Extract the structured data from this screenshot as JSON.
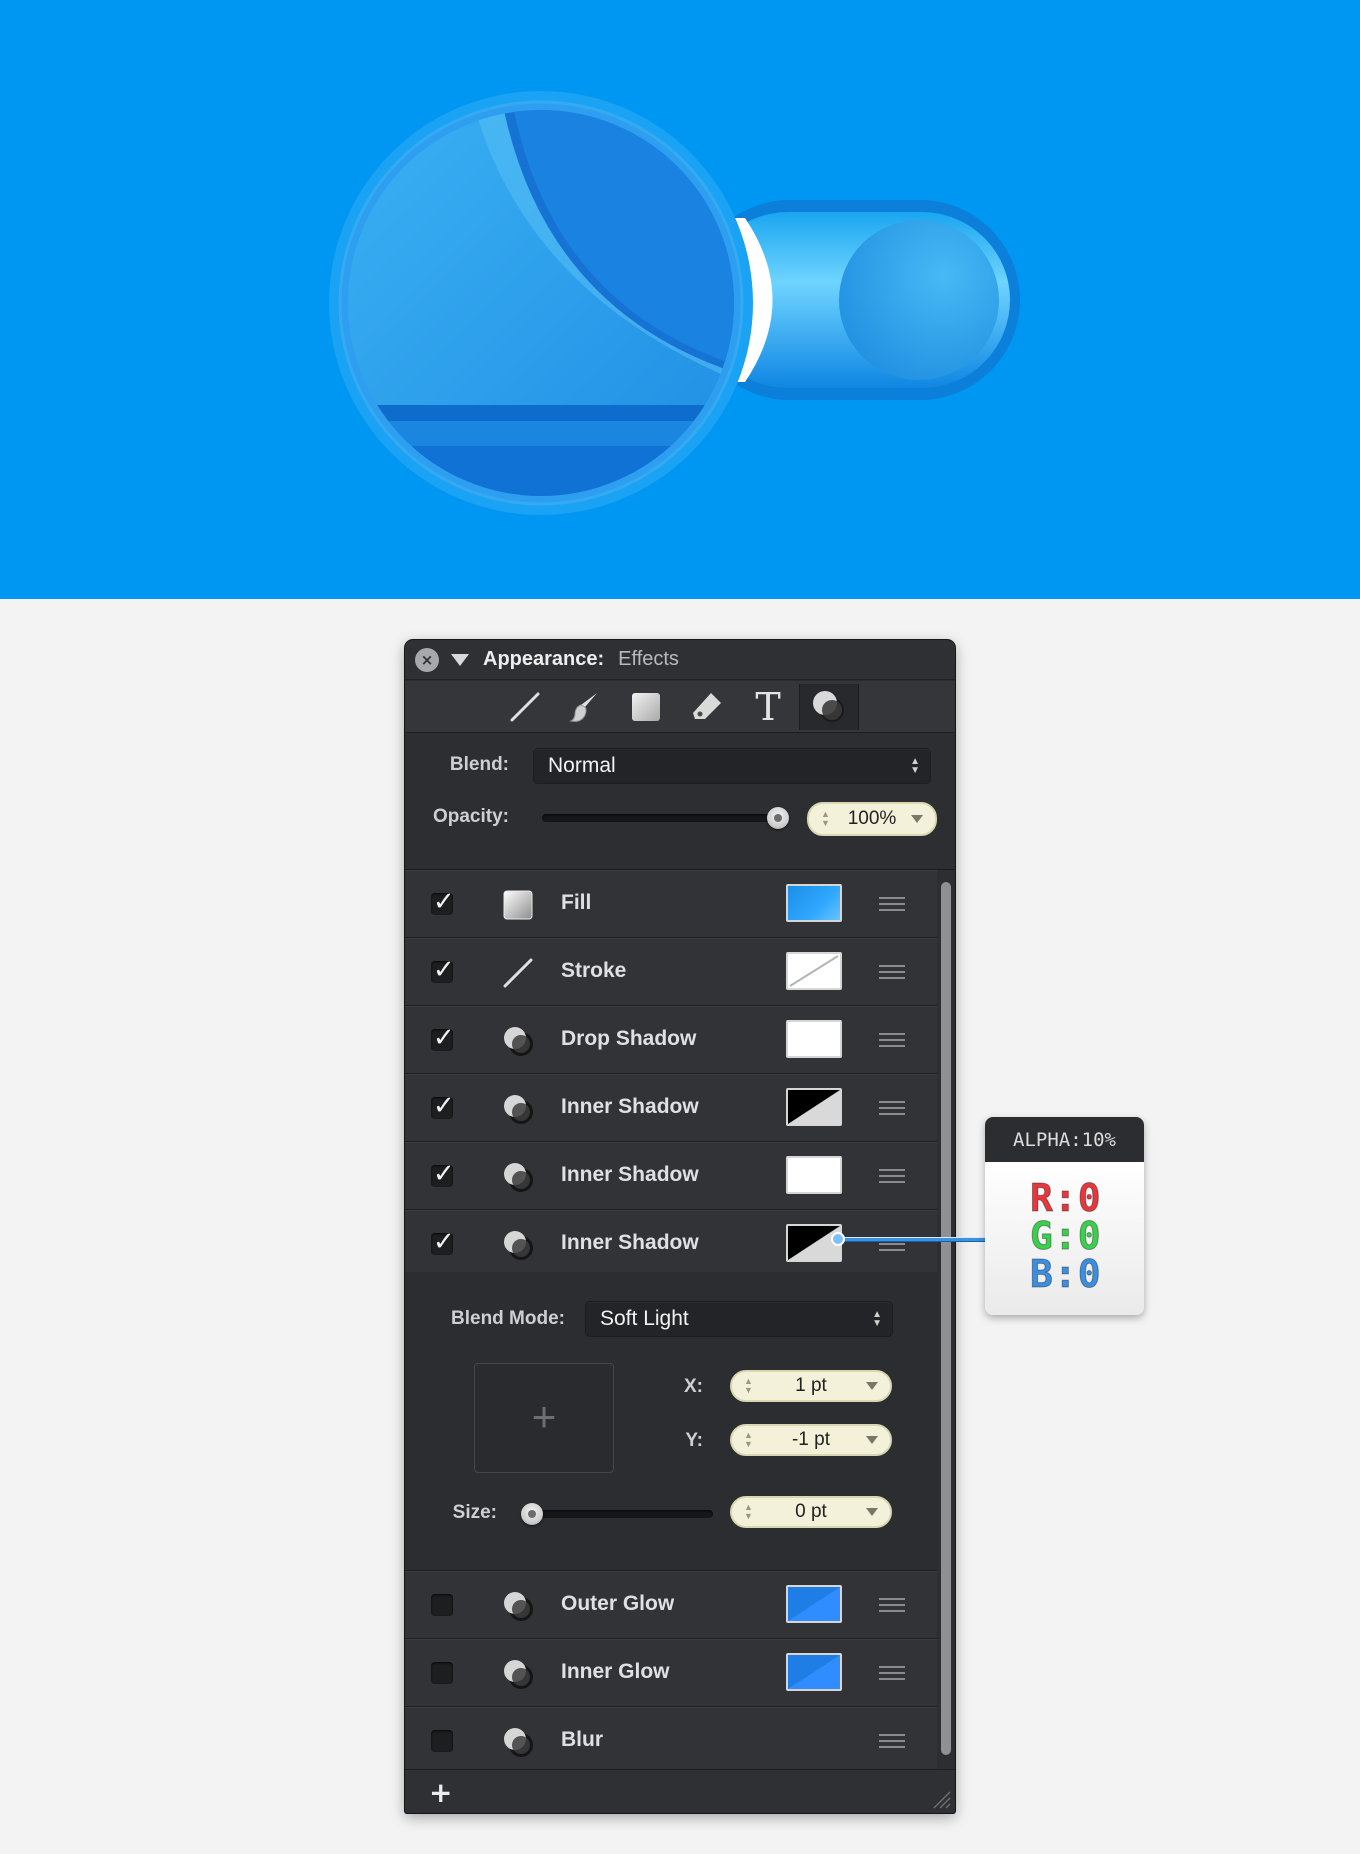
{
  "colors": {
    "hero_bg": "#0097f2",
    "panel_bg": "#2b2c2f",
    "fill_swatch": "#2fa6ff",
    "glow_swatch": "#2f8dff",
    "red": "#e6373c",
    "green": "#3ccf4e",
    "blue": "#3b8fe0"
  },
  "panel": {
    "title": "Appearance:",
    "subtitle": "Effects",
    "tools": [
      {
        "icon": "line-tool-icon"
      },
      {
        "icon": "brush-tool-icon"
      },
      {
        "icon": "square-tool-icon"
      },
      {
        "icon": "eraser-tool-icon"
      },
      {
        "icon": "text-tool-icon",
        "glyph": "T"
      },
      {
        "icon": "effects-tool-icon"
      }
    ],
    "blend_label": "Blend:",
    "blend_value": "Normal",
    "opacity_label": "Opacity:",
    "opacity_value": "100%",
    "opacity_level": 1.0
  },
  "effects": [
    {
      "name": "Fill",
      "checked": true,
      "icon": "fill-icon",
      "swatch": "blue-gradient"
    },
    {
      "name": "Stroke",
      "checked": true,
      "icon": "stroke-icon",
      "swatch": "white-slash"
    },
    {
      "name": "Drop Shadow",
      "checked": true,
      "icon": "shadow-icon",
      "swatch": "white"
    },
    {
      "name": "Inner Shadow",
      "checked": true,
      "icon": "shadow-icon",
      "swatch": "black-white-diagonal"
    },
    {
      "name": "Inner Shadow",
      "checked": true,
      "icon": "shadow-icon",
      "swatch": "white"
    },
    {
      "name": "Inner Shadow",
      "checked": true,
      "icon": "shadow-icon",
      "swatch": "black-white-diagonal"
    },
    {
      "name": "Outer Glow",
      "checked": false,
      "icon": "shadow-icon",
      "swatch": "blue-diagonal"
    },
    {
      "name": "Inner Glow",
      "checked": false,
      "icon": "shadow-icon",
      "swatch": "blue-diagonal"
    },
    {
      "name": "Blur",
      "checked": false,
      "icon": "shadow-icon",
      "swatch": "none"
    }
  ],
  "detail": {
    "blend_mode_label": "Blend Mode:",
    "blend_mode_value": "Soft Light",
    "x_label": "X:",
    "x_value": "1 pt",
    "y_label": "Y:",
    "y_value": "-1 pt",
    "size_label": "Size:",
    "size_value": "0 pt",
    "size_level": 0.0
  },
  "callout": {
    "header": "ALPHA:10%",
    "r": "R:0",
    "g": "G:0",
    "b": "B:0"
  },
  "footer": {
    "add_glyph": "+"
  }
}
